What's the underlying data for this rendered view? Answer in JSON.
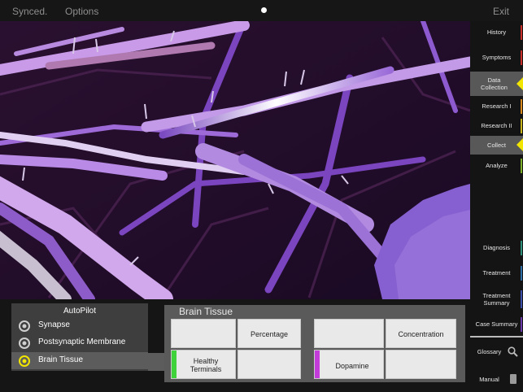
{
  "topbar": {
    "sync_label": "Synced.",
    "options_label": "Options",
    "exit_label": "Exit"
  },
  "sidebar": {
    "items": [
      {
        "label": "History",
        "bar_color": "#c9302c"
      },
      {
        "label": "Symptoms",
        "bar_color": "#c9302c"
      },
      {
        "label": "Data Collection",
        "bar_color": "#d98a1c",
        "active": true
      },
      {
        "label": "Research I",
        "bar_color": "#d98a1c"
      },
      {
        "label": "Research II",
        "bar_color": "#c7b31c"
      },
      {
        "label": "Collect",
        "bar_color": "#c7b31c",
        "active": true
      },
      {
        "label": "Analyze",
        "bar_color": "#7cae2a"
      },
      {
        "label": "Diagnosis",
        "bar_color": "#2f8f7a"
      },
      {
        "label": "Treatment",
        "bar_color": "#2f6fa8"
      },
      {
        "label": "Treatment Summary",
        "bar_color": "#3b4fa8"
      },
      {
        "label": "Case Summary",
        "bar_color": "#6a3ba8"
      },
      {
        "label": "Glossary",
        "icon": "search-icon"
      },
      {
        "label": "Manual",
        "icon": "book-icon"
      }
    ]
  },
  "autopilot": {
    "title": "AutoPilot",
    "items": [
      {
        "label": "Synapse",
        "icon": "target-icon"
      },
      {
        "label": "Postsynaptic Membrane",
        "icon": "target-icon"
      },
      {
        "label": "Brain Tissue",
        "icon": "target-icon",
        "active": true
      }
    ]
  },
  "panel": {
    "title": "Brain Tissue",
    "table1": {
      "header": "Percentage",
      "row_label": "Healthy Terminals",
      "value": "",
      "swatch_color": "#3fd23a"
    },
    "table2": {
      "header": "Concentration",
      "row_label": "Dopamine",
      "value": "",
      "swatch_color": "#c33bd8"
    }
  },
  "colors": {
    "accent": "#f2e600",
    "viewport_bg": "#1a0d22",
    "fiber_light": "#c9a8e6",
    "fiber_dark": "#6a3aa0"
  }
}
